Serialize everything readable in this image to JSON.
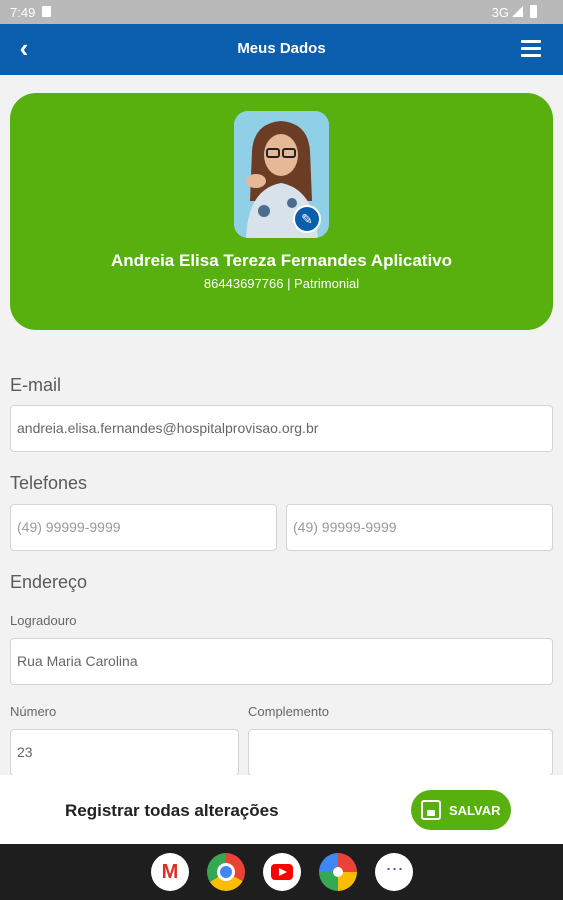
{
  "status_bar": {
    "time": "7:49",
    "network": "3G"
  },
  "app_bar": {
    "back_symbol": "‹",
    "title": "Meus Dados"
  },
  "profile": {
    "name": "Andreia Elisa Tereza Fernandes Aplicativo",
    "subtitle": "86443697766 | Patrimonial",
    "edit_symbol": "✎"
  },
  "email_section": {
    "label": "E-mail",
    "value": "andreia.elisa.fernandes@hospitalprovisao.org.br"
  },
  "phones_section": {
    "label": "Telefones",
    "phone1_placeholder": "(49) 99999-9999",
    "phone2_placeholder": "(49) 99999-9999"
  },
  "address_section": {
    "label": "Endereço",
    "street_label": "Logradouro",
    "street_value": "Rua Maria Carolina",
    "number_label": "Número",
    "number_value": "23",
    "complement_label": "Complemento",
    "complement_value": ""
  },
  "bottom_bar": {
    "register_text": "Registrar todas alterações",
    "save_label": "SALVAR"
  },
  "colors": {
    "primary_blue": "#0a5ead",
    "accent_green": "#57b00d",
    "background": "#f2f2f2"
  },
  "nav_apps": [
    "gmail-icon",
    "chrome-icon",
    "youtube-icon",
    "photos-icon",
    "apps-icon"
  ]
}
